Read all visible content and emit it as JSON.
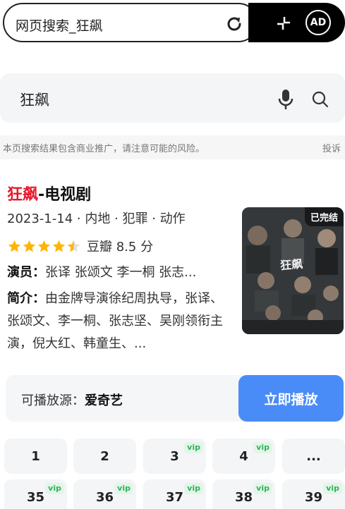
{
  "address_bar": {
    "url_text": "网页搜索_狂飙",
    "ad_label": "AD"
  },
  "search": {
    "query": "狂飙"
  },
  "notice": {
    "text": "本页搜索结果包含商业推广，请注意可能的风险。",
    "report": "投诉"
  },
  "result": {
    "title_highlight": "狂飙",
    "title_rest": "-电视剧",
    "meta": "2023-1-14 · 内地 · 犯罪 · 动作",
    "rating_text": "豆瓣 8.5 分",
    "rating_stars": 4.25,
    "cast_label": "演员：",
    "cast": "张译 张颂文 李一桐 张志...",
    "intro_label": "简介：",
    "intro": "由金牌导演徐纪周执导，张译、张颂文、李一桐、张志坚、吴刚领衔主演，倪大红、韩童生、...",
    "poster_badge": "已完结",
    "poster_title": "狂飙"
  },
  "source": {
    "label": "可播放源：",
    "name": "爱奇艺",
    "play_button": "立即播放"
  },
  "episodes": {
    "row1": [
      {
        "label": "1",
        "vip": ""
      },
      {
        "label": "2",
        "vip": ""
      },
      {
        "label": "3",
        "vip": "vip"
      },
      {
        "label": "4",
        "vip": "vip"
      },
      {
        "label": "...",
        "vip": ""
      }
    ],
    "row2": [
      {
        "label": "35",
        "vip": "vip"
      },
      {
        "label": "36",
        "vip": "vip"
      },
      {
        "label": "37",
        "vip": "vip"
      },
      {
        "label": "38",
        "vip": "vip"
      },
      {
        "label": "39",
        "vip": "vip"
      }
    ]
  },
  "colors": {
    "highlight": "#e8172b",
    "play_button": "#4a8cf7",
    "star": "#ffb400",
    "vip": "#31b35b"
  }
}
